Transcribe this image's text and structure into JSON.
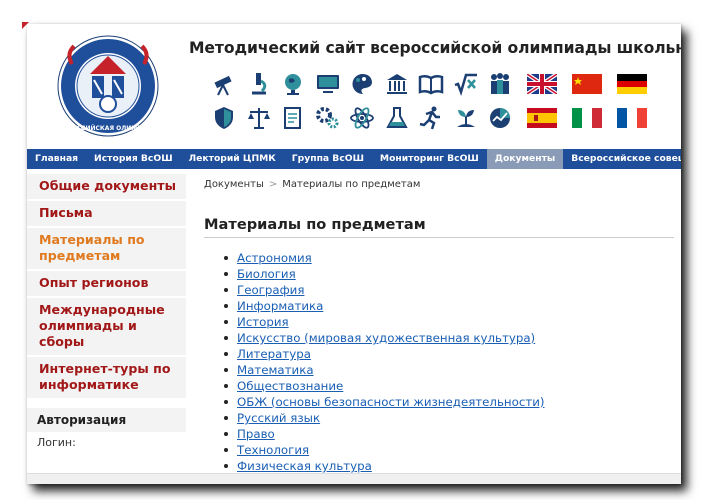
{
  "site": {
    "title": "Методический сайт всероссийской олимпиады школьников",
    "logo_text": "ВСЕРОССИЙСКАЯ ОЛИМПИАДА ШКОЛЬНИКОВ"
  },
  "subject_icons": {
    "row1": [
      "telescope-icon",
      "microscope-icon",
      "globe-icon",
      "computer-icon",
      "palette-icon",
      "museum-icon",
      "book-icon",
      "math-icon",
      "people-icon"
    ],
    "row2": [
      "shield-icon",
      "scales-icon",
      "document-icon",
      "gears-icon",
      "atom-icon",
      "chemistry-icon",
      "runner-icon",
      "plant-icon",
      "economics-icon"
    ]
  },
  "flags": {
    "row1": [
      "flag-uk-icon",
      "flag-china-icon",
      "flag-germany-icon"
    ],
    "row2": [
      "flag-spain-icon",
      "flag-italy-icon",
      "flag-france-icon"
    ]
  },
  "nav": {
    "items": [
      {
        "label": "Главная"
      },
      {
        "label": "История ВсОШ"
      },
      {
        "label": "Лекторий ЦПМК"
      },
      {
        "label": "Группа ВсОШ"
      },
      {
        "label": "Мониторинг ВсОШ"
      },
      {
        "label": "Документы"
      },
      {
        "label": "Всероссийское совещание"
      }
    ]
  },
  "sidebar": {
    "items": [
      {
        "label": "Общие документы"
      },
      {
        "label": "Письма"
      },
      {
        "label": "Материалы по предметам"
      },
      {
        "label": "Опыт регионов"
      },
      {
        "label": "Международные олимпиады и сборы"
      },
      {
        "label": "Интернет-туры по информатике"
      }
    ],
    "auth_title": "Авторизация",
    "login_label": "Логин:"
  },
  "breadcrumb": {
    "root": "Документы",
    "separator": ">",
    "current": "Материалы по предметам"
  },
  "main": {
    "title": "Материалы по предметам",
    "subjects": [
      "Астрономия",
      "Биология",
      "География",
      "Информатика",
      "История",
      "Искусство (мировая художественная культура)",
      "Литература",
      "Математика",
      "Обществознание",
      "ОБЖ (основы безопасности жизнедеятельности)",
      "Русский язык",
      "Право",
      "Технология",
      "Физическая культура"
    ]
  },
  "colors": {
    "nav_bg": "#1f4e9a",
    "nav_active": "#8a9bb7",
    "sidebar_text": "#a21818",
    "sidebar_active": "#e07a1f",
    "link": "#1a5fb4",
    "icon_dark": "#1c3f73",
    "icon_teal": "#2f8f9a"
  }
}
